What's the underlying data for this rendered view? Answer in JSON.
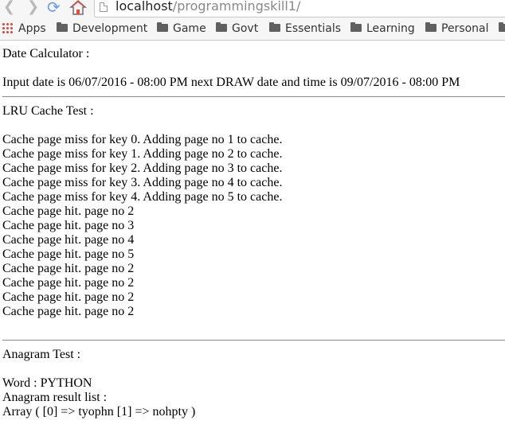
{
  "browser": {
    "url_host": "localhost",
    "url_path": "/programmingskill1/",
    "bookmarks": [
      "Apps",
      "Development",
      "Game",
      "Govt",
      "Essentials",
      "Learning",
      "Personal"
    ]
  },
  "page": {
    "date_title": "Date Calculator :",
    "date_result": "Input date is 06/07/2016 - 08:00 PM next DRAW date and time is 09/07/2016 - 08:00 PM",
    "lru_title": "LRU Cache Test :",
    "lru_lines": [
      "Cache page miss for key 0. Adding page no 1 to cache.",
      "Cache page miss for key 1. Adding page no 2 to cache.",
      "Cache page miss for key 2. Adding page no 3 to cache.",
      "Cache page miss for key 3. Adding page no 4 to cache.",
      "Cache page miss for key 4. Adding page no 5 to cache.",
      "Cache page hit. page no 2",
      "Cache page hit. page no 3",
      "Cache page hit. page no 4",
      "Cache page hit. page no 5",
      "Cache page hit. page no 2",
      "Cache page hit. page no 2",
      "Cache page hit. page no 2",
      "Cache page hit. page no 2"
    ],
    "anagram_title": "Anagram Test :",
    "word": "Word : PYTHON",
    "anagram_list_label": "Anagram result list :",
    "anagram_array": "Array ( [0] => tyophn [1] => nohpty )"
  }
}
